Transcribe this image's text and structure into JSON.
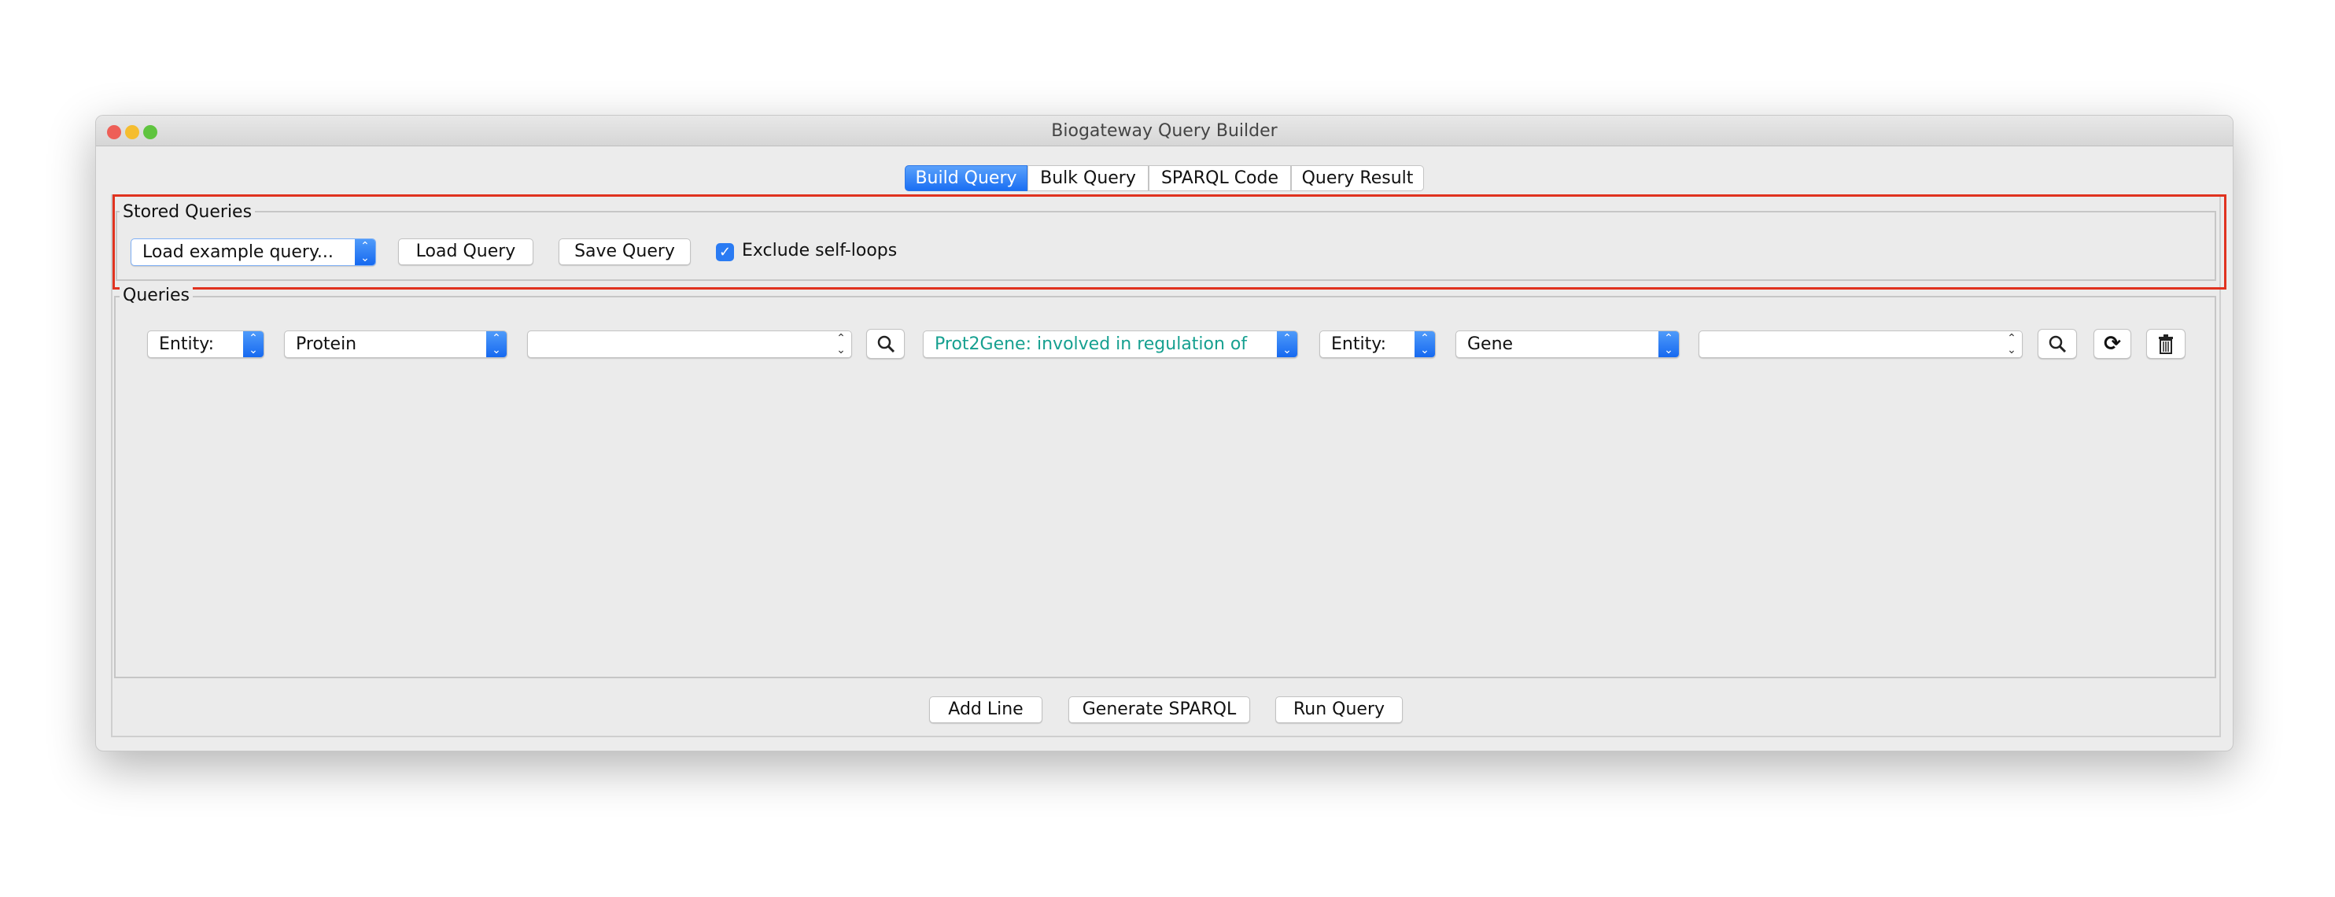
{
  "window": {
    "title": "Biogateway Query Builder"
  },
  "tabs": [
    {
      "label": "Build Query",
      "active": true
    },
    {
      "label": "Bulk Query"
    },
    {
      "label": "SPARQL Code"
    },
    {
      "label": "Query Result"
    }
  ],
  "stored_queries": {
    "label": "Stored Queries",
    "example_select": "Load example query...",
    "load_button": "Load Query",
    "save_button": "Save Query",
    "exclude_self_loops": {
      "label": "Exclude self-loops",
      "checked": true
    }
  },
  "queries": {
    "label": "Queries",
    "row": {
      "entity1_type": "Entity:",
      "entity1_value": "Protein",
      "entity1_search": "",
      "relation": "Prot2Gene: involved in regulation of",
      "entity2_type": "Entity:",
      "entity2_value": "Gene",
      "entity2_search": ""
    }
  },
  "footer": {
    "add_line": "Add Line",
    "generate_sparql": "Generate SPARQL",
    "run_query": "Run Query"
  },
  "colors": {
    "accent": "#1a6ff3",
    "relation_text": "#16a090",
    "highlight_box": "#e0321f"
  }
}
